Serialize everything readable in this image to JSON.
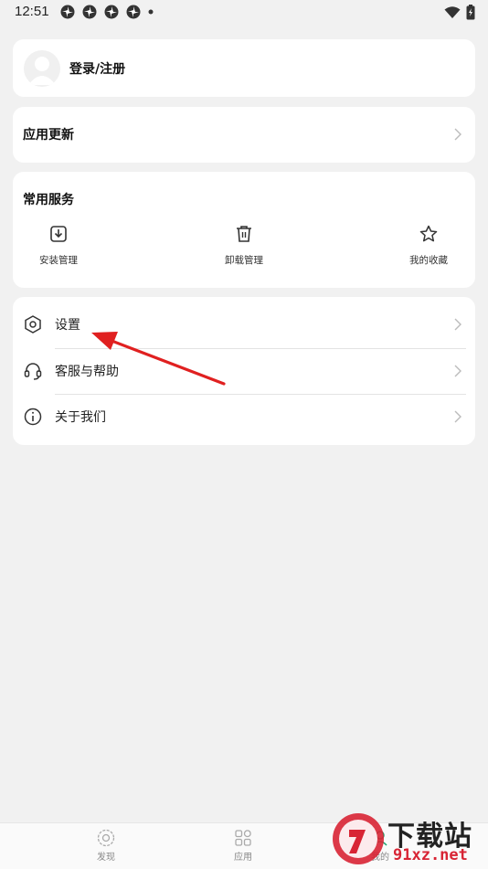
{
  "status_bar": {
    "time": "12:51",
    "notification_icons": [
      "pinwheel-icon",
      "pinwheel-icon",
      "pinwheel-icon",
      "pinwheel-icon",
      "dot-icon"
    ],
    "right_icons": [
      "wifi-icon",
      "battery-charging-icon"
    ]
  },
  "account": {
    "login_label": "登录/注册"
  },
  "app_update": {
    "label": "应用更新"
  },
  "services": {
    "title": "常用服务",
    "items": [
      {
        "label": "安装管理",
        "icon": "install-download-icon"
      },
      {
        "label": "卸载管理",
        "icon": "trash-icon"
      },
      {
        "label": "我的收藏",
        "icon": "star-icon"
      }
    ]
  },
  "menu": {
    "items": [
      {
        "label": "设置",
        "icon": "settings-hexagon-icon"
      },
      {
        "label": "客服与帮助",
        "icon": "headset-icon"
      },
      {
        "label": "关于我们",
        "icon": "info-icon"
      }
    ]
  },
  "bottom_nav": {
    "items": [
      {
        "label": "发现",
        "icon": "discover-icon"
      },
      {
        "label": "应用",
        "icon": "apps-grid-icon"
      },
      {
        "label": "我的",
        "icon": "me-icon"
      }
    ]
  },
  "watermark": {
    "top": "下载站",
    "bottom": "91xz.net"
  },
  "colors": {
    "background": "#f1f1f1",
    "card": "#ffffff",
    "annotation_arrow": "#e02020",
    "watermark_red": "#d82434"
  }
}
